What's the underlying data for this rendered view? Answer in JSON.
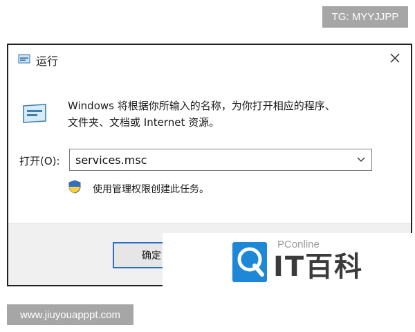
{
  "tg_badge": "TG: MYYJJPP",
  "dialog": {
    "title": "运行",
    "description_line1": "Windows 将根据你所输入的名称，为你打开相应的程序、",
    "description_line2": "文件夹、文档或 Internet 资源。",
    "open_label": "打开(O):",
    "open_value": "services.msc",
    "admin_note": "使用管理权限创建此任务。",
    "ok_button": "确定",
    "icons": {
      "title": "run-icon",
      "big": "run-icon",
      "close": "close-icon",
      "caret": "chevron-down-icon",
      "shield": "shield-icon"
    },
    "colors": {
      "focus_border": "#2a6ecb"
    }
  },
  "watermark": {
    "small": "PConline",
    "big": "IT百科"
  },
  "site_badge": "www.jiuyouapppt.com"
}
